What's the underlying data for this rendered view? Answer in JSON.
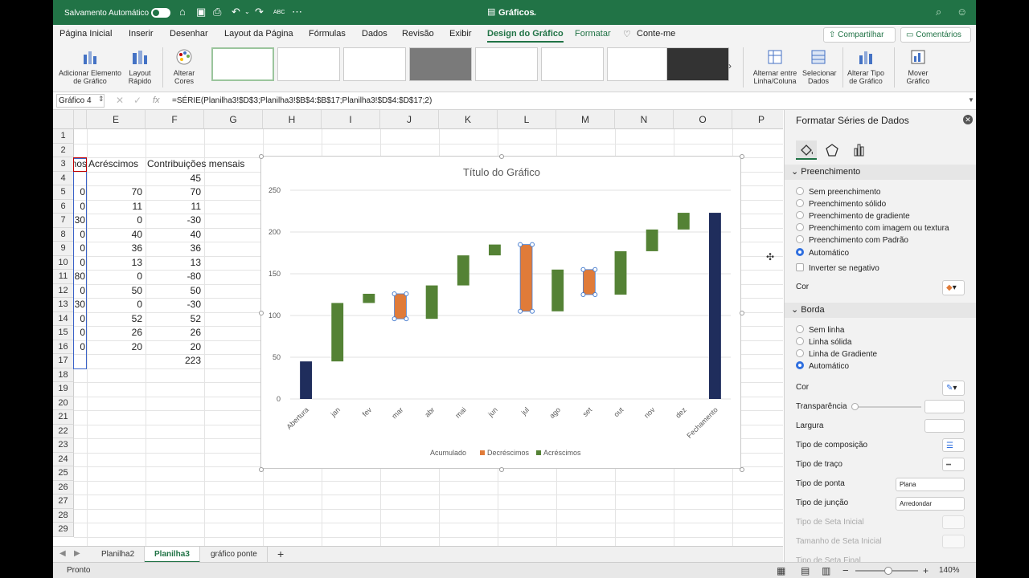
{
  "titlebar": {
    "autosave_label": "Salvamento Automático",
    "workbook_title": "Gráficos",
    "spellcheck_label": "ABC"
  },
  "tabs": [
    "Página Inicial",
    "Inserir",
    "Desenhar",
    "Layout da Página",
    "Fórmulas",
    "Dados",
    "Revisão",
    "Exibir",
    "Design do Gráfico",
    "Formatar",
    "Conte-me"
  ],
  "active_tab": "Design do Gráfico",
  "header_buttons": {
    "share": "Compartilhar",
    "comments": "Comentários"
  },
  "ribbon": {
    "add_element": "Adicionar Elemento de Gráfico",
    "quick_layout": "Layout Rápido",
    "change_colors": "Alterar Cores",
    "switch_row_col": "Alternar entre Linha/Coluna",
    "select_data": "Selecionar Dados",
    "change_type": "Alterar Tipo de Gráfico",
    "move_chart": "Mover Gráfico"
  },
  "formula_bar": {
    "name_box": "Gráfico 4",
    "fx": "fx",
    "formula": "=SÉRIE(Planilha3!$D$3;Planilha3!$B$4:$B$17;Planilha3!$D$4:$D$17;2)"
  },
  "columns": [
    "E",
    "F",
    "G",
    "H",
    "I",
    "J",
    "K",
    "L",
    "M",
    "N",
    "O",
    "P"
  ],
  "rows": [
    "1",
    "2",
    "3",
    "4",
    "5",
    "6",
    "7",
    "8",
    "9",
    "10",
    "11",
    "12",
    "13",
    "14",
    "15",
    "16",
    "17",
    "18",
    "19",
    "20",
    "21",
    "22",
    "23",
    "24",
    "25",
    "26",
    "27",
    "28",
    "29"
  ],
  "sheet_cells": {
    "d_header_fragment": "nos",
    "e_header": "Acréscimos",
    "f_header": "Contribuições mensais",
    "d_values": [
      "",
      "0",
      "0",
      "30",
      "0",
      "0",
      "0",
      "80",
      "0",
      "30",
      "0",
      "0",
      "0",
      ""
    ],
    "e_values": [
      "",
      "70",
      "11",
      "0",
      "40",
      "36",
      "13",
      "0",
      "50",
      "0",
      "52",
      "26",
      "20",
      ""
    ],
    "f_values": [
      "45",
      "70",
      "11",
      "-30",
      "40",
      "36",
      "13",
      "-80",
      "50",
      "-30",
      "52",
      "26",
      "20",
      "223"
    ]
  },
  "chart_data": {
    "type": "bar",
    "title": "Título do Gráfico",
    "categories": [
      "Abertura",
      "jan",
      "fev",
      "mar",
      "abr",
      "mai",
      "jun",
      "jul",
      "ago",
      "set",
      "out",
      "nov",
      "dez",
      "Fechamento"
    ],
    "series": [
      {
        "name": "Acumulado",
        "values": [
          45,
          45,
          115,
          96,
          96,
          136,
          172,
          105,
          105,
          125,
          125,
          177,
          203,
          223
        ]
      },
      {
        "name": "Decréscimos",
        "values": [
          0,
          0,
          0,
          30,
          0,
          0,
          0,
          80,
          0,
          30,
          0,
          0,
          0,
          0
        ]
      },
      {
        "name": "Acréscimos",
        "values": [
          0,
          70,
          11,
          0,
          40,
          36,
          13,
          0,
          50,
          0,
          52,
          26,
          20,
          0
        ]
      }
    ],
    "ylim": [
      0,
      250
    ],
    "yticks": [
      0,
      50,
      100,
      150,
      200,
      250
    ],
    "grid": true,
    "legend": "bottom",
    "colors": {
      "Acumulado": "#1f2d5c",
      "Decréscimos": "#e07b39",
      "Acréscimos": "#548235"
    }
  },
  "format_pane": {
    "title": "Formatar Séries de Dados",
    "fill_section": "Preenchimento",
    "fill_options": [
      "Sem preenchimento",
      "Preenchimento sólido",
      "Preenchimento de gradiente",
      "Preenchimento com imagem ou textura",
      "Preenchimento com Padrão",
      "Automático"
    ],
    "invert_label": "Inverter se negativo",
    "color_label": "Cor",
    "border_section": "Borda",
    "border_options": [
      "Sem linha",
      "Linha sólida",
      "Linha de Gradiente",
      "Automático"
    ],
    "border_color_label": "Cor",
    "transparency_label": "Transparência",
    "width_label": "Largura",
    "compound_label": "Tipo de composição",
    "dash_label": "Tipo de traço",
    "cap_label": "Tipo de ponta",
    "cap_value": "Plana",
    "join_label": "Tipo de junção",
    "join_value": "Arredondar",
    "begin_arrow_label": "Tipo de Seta Inicial",
    "begin_arrow_size_label": "Tamanho de Seta Inicial",
    "end_arrow_label": "Tipo de Seta Final"
  },
  "sheet_tabs": [
    "Planilha2",
    "Planilha3",
    "gráfico ponte"
  ],
  "active_sheet": "Planilha3",
  "status": {
    "ready": "Pronto",
    "zoom": "140%",
    "zoom_value": 1.4
  }
}
